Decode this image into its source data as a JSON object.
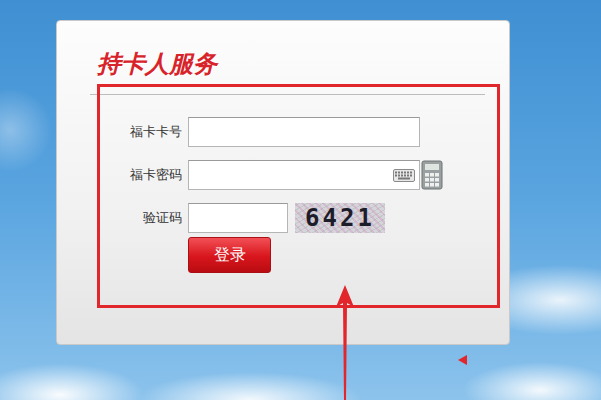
{
  "panel": {
    "title": "持卡人服务"
  },
  "fields": [
    {
      "label": "福卡卡号",
      "kind": "text",
      "value": ""
    },
    {
      "label": "福卡密码",
      "kind": "password",
      "value": ""
    },
    {
      "label": "验证码",
      "kind": "captcha",
      "value": ""
    }
  ],
  "captcha": {
    "code": "6421"
  },
  "buttons": [
    "登录"
  ]
}
